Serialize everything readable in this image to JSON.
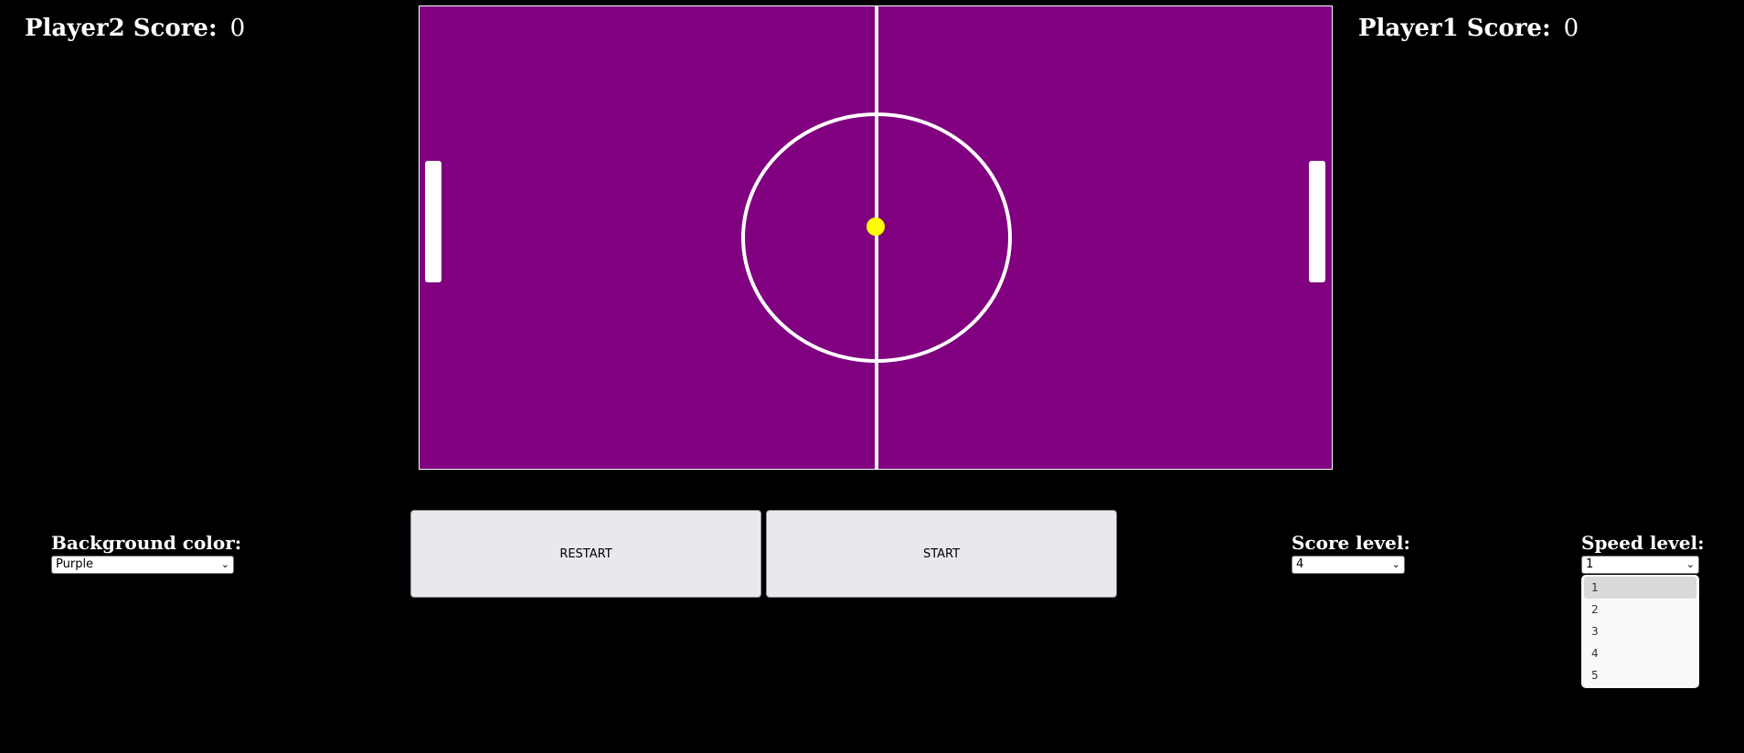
{
  "scores": {
    "player2": {
      "label": "Player2 Score:",
      "value": "0"
    },
    "player1": {
      "label": "Player1 Score:",
      "value": "0"
    }
  },
  "field": {
    "background_color": "#800080",
    "line_color": "#ffffff",
    "ball_color": "#ffff00",
    "paddle_color": "#ffffff"
  },
  "controls": {
    "background": {
      "label": "Background color:",
      "selected": "Purple"
    },
    "restart_label": "RESTART",
    "start_label": "START",
    "score_level": {
      "label": "Score level:",
      "selected": "4"
    },
    "speed_level": {
      "label": "Speed level:",
      "selected": "1",
      "options": [
        "1",
        "2",
        "3",
        "4",
        "5"
      ],
      "dropdown_open": true
    }
  },
  "icons": {
    "select_chevron": "chevron-down-icon"
  }
}
